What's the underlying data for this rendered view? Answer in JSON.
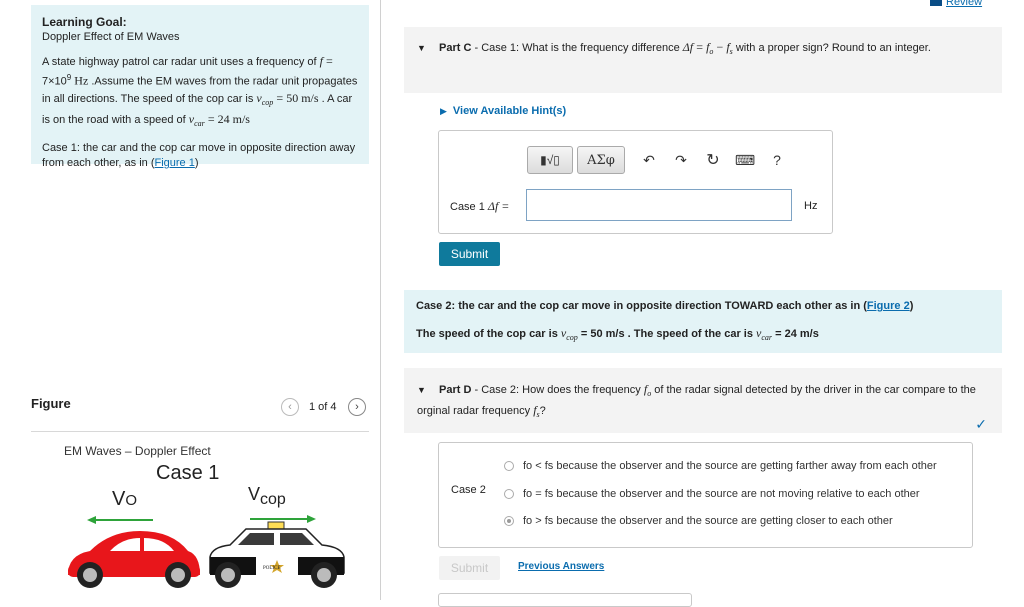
{
  "header": {
    "review_label": "Review"
  },
  "goal": {
    "heading": "Learning Goal:",
    "title": "Doppler Effect of EM Waves",
    "p1": "A state highway patrol car radar unit uses a frequency of",
    "p1_var": "f",
    "p1_mant": "7×10",
    "p1_exp": "9",
    "p1_unit": "Hz",
    "p2": ".Assume the EM waves from the radar unit propagates in all directions. The speed of the cop car is",
    "v_sym": "v",
    "vcop_sub": "cop",
    "vcop_val": "50 m/s",
    "p3": ". A car is on the road with a speed of",
    "vcar_sub": "car",
    "vcar_val": "= 24 m/s",
    "case1_text": "Case 1: the car and the cop car move in opposite direction away from each other, as in (",
    "case1_link": "Figure 1",
    "case1_close": ")"
  },
  "figure": {
    "label": "Figure",
    "pager": "1 of 4",
    "caption": "EM Waves – Doppler Effect",
    "case_title": "Case 1",
    "vo_label": "V",
    "vo_sub": "O",
    "vcop_label": "V",
    "vcop_sub": "cop",
    "police_text": "POLICE",
    "colors": {
      "car": "#e8161b",
      "arrow": "#2ea33a"
    }
  },
  "partC": {
    "part_label": "Part C",
    "question": "Case 1: What is the frequency difference",
    "delta_f": "Δf",
    "eq": "=",
    "f_sym": "f",
    "fo_sub": "o",
    "minus": "−",
    "fs_sub": "s",
    "question_end": "with a proper sign? Round to an integer.",
    "hint_label": "View Available Hint(s)",
    "toolbar": {
      "templates": "▮√▯",
      "greek": "ΑΣφ",
      "undo": "↶",
      "redo": "↷",
      "reset": "↻",
      "keyboard": "⌨",
      "help": "?"
    },
    "input_label": "Case 1",
    "input_math": "Δf =",
    "input_value": "",
    "unit": "Hz",
    "submit_label": "Submit"
  },
  "case2": {
    "line1": "Case 2: the car and the cop car move in opposite direction TOWARD each other as in (",
    "line1_link": "Figure 2",
    "line1_close": ")",
    "line2_a": "The speed of the cop car is",
    "v_sym": "v",
    "vcop_sub": "cop",
    "vcop_val": "= 50 m/s",
    "line2_b": ". The speed of the car is",
    "vcar_sub": "car",
    "vcar_val": "= 24 m/s"
  },
  "partD": {
    "part_label": "Part D",
    "question_a": "Case 2: How does the frequency",
    "f_sym": "f",
    "fo_sub": "o",
    "question_b": "of the radar signal detected by the driver in the car compare to the orginal radar frequency",
    "fs_sub": "s",
    "question_end": "?",
    "case_label": "Case 2",
    "options": [
      "fo < fs because the observer and the source are getting farther away from each other",
      "fo = fs because the observer and the source are not moving relative to each other",
      "fo > fs because the observer and the source are getting closer to each other"
    ],
    "selected_index": 2,
    "submit_label": "Submit",
    "previous_answers": "Previous Answers"
  }
}
